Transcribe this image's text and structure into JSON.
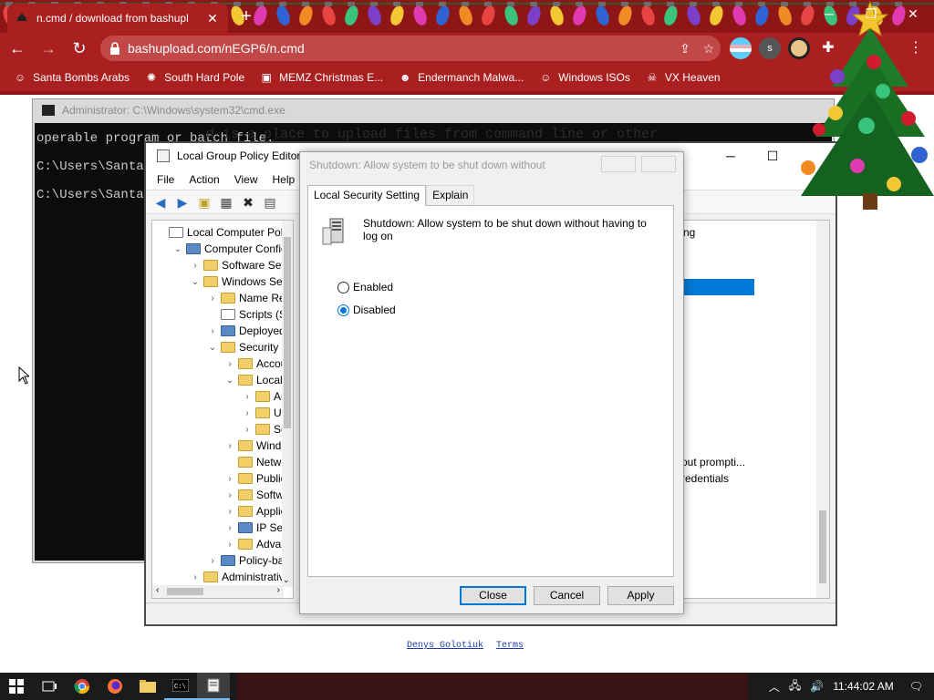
{
  "browser": {
    "tab_title": "n.cmd / download from bashupl",
    "tab_close": "✕",
    "new_tab": "+",
    "window_controls": {
      "minimize": "─",
      "restore": "❐",
      "close": "✕"
    },
    "url": "bashupload.com/nEGP6/n.cmd",
    "nav": {
      "back": "←",
      "forward": "→",
      "reload": "↻"
    },
    "omnibox_icons": {
      "share": "⇪",
      "star": "☆"
    },
    "menu_dots": "⋮",
    "profile_letter": "s",
    "bookmarks": [
      {
        "label": "Santa Bombs Arabs",
        "icon": "person-icon"
      },
      {
        "label": "South Hard Pole",
        "icon": "gear-icon"
      },
      {
        "label": "MEMZ Christmas E...",
        "icon": "image-icon"
      },
      {
        "label": "Endermanch Malwa...",
        "icon": "cat-icon"
      },
      {
        "label": "Windows ISOs",
        "icon": "person-icon"
      },
      {
        "label": "VX Heaven",
        "icon": "skull-icon"
      }
    ]
  },
  "cmd": {
    "title": "Administrator: C:\\Windows\\system32\\cmd.exe",
    "lines": [
      "operable program or batch file.",
      "C:\\Users\\Santa",
      "C:\\Users\\Santa"
    ],
    "ghost_text": "d is a place to upload files from command line or other"
  },
  "gpe": {
    "title": "Local Group Policy Editor",
    "menu": [
      "File",
      "Action",
      "View",
      "Help"
    ],
    "tree": [
      {
        "label": "Local Computer Polic",
        "depth": 0,
        "chev": "",
        "icon": "doc"
      },
      {
        "label": "Computer Config",
        "depth": 1,
        "chev": "⌄",
        "icon": "pc"
      },
      {
        "label": "Software Setti",
        "depth": 2,
        "chev": "›",
        "icon": "folder"
      },
      {
        "label": "Windows Sett",
        "depth": 2,
        "chev": "⌄",
        "icon": "folder"
      },
      {
        "label": "Name Res",
        "depth": 3,
        "chev": "›",
        "icon": "folder"
      },
      {
        "label": "Scripts (Sta",
        "depth": 3,
        "chev": "",
        "icon": "doc"
      },
      {
        "label": "Deployed",
        "depth": 3,
        "chev": "›",
        "icon": "pc"
      },
      {
        "label": "Security Se",
        "depth": 3,
        "chev": "⌄",
        "icon": "folder"
      },
      {
        "label": "Accou",
        "depth": 4,
        "chev": "›",
        "icon": "folder"
      },
      {
        "label": "Local P",
        "depth": 4,
        "chev": "⌄",
        "icon": "folder"
      },
      {
        "label": "Au",
        "depth": 5,
        "chev": "›",
        "icon": "folder"
      },
      {
        "label": "Use",
        "depth": 5,
        "chev": "›",
        "icon": "folder"
      },
      {
        "label": "Sec",
        "depth": 5,
        "chev": "›",
        "icon": "folder"
      },
      {
        "label": "Windo",
        "depth": 4,
        "chev": "›",
        "icon": "folder"
      },
      {
        "label": "Netwo",
        "depth": 4,
        "chev": "",
        "icon": "folder"
      },
      {
        "label": "Public",
        "depth": 4,
        "chev": "›",
        "icon": "folder"
      },
      {
        "label": "Softwa",
        "depth": 4,
        "chev": "›",
        "icon": "folder"
      },
      {
        "label": "Applic",
        "depth": 4,
        "chev": "›",
        "icon": "folder"
      },
      {
        "label": "IP Secu",
        "depth": 4,
        "chev": "›",
        "icon": "pc"
      },
      {
        "label": "Advan",
        "depth": 4,
        "chev": "›",
        "icon": "folder"
      },
      {
        "label": "Policy-bas",
        "depth": 3,
        "chev": "›",
        "icon": "pc"
      },
      {
        "label": "Administrative",
        "depth": 2,
        "chev": "›",
        "icon": "folder"
      }
    ],
    "right_header": "ng",
    "right_rows": [
      "out prompti...",
      "redentials"
    ]
  },
  "dialog": {
    "title": "Shutdown: Allow system to be shut down without",
    "tabs": [
      "Local Security Setting",
      "Explain"
    ],
    "policy_name": "Shutdown: Allow system to be shut down without having to log on",
    "options": [
      {
        "label": "Enabled",
        "checked": false
      },
      {
        "label": "Disabled",
        "checked": true
      }
    ],
    "buttons": {
      "close": "Close",
      "cancel": "Cancel",
      "apply": "Apply"
    }
  },
  "page": {
    "footer_links": [
      "Denys Golotiuk",
      "Terms"
    ]
  },
  "taskbar": {
    "time": "11:44:02 AM",
    "tray_chevron": "︿",
    "network": "🖧",
    "volume": "🔊",
    "notification": "🗨"
  },
  "colors": {
    "chrome_red": "#aa1f1f",
    "selection_blue": "#0078d7",
    "taskbar": "#1b1b1b"
  }
}
